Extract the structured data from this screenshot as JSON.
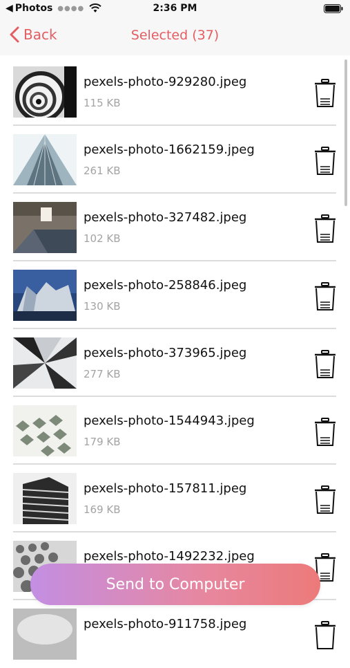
{
  "status_bar": {
    "back_app": "Photos",
    "time": "2:36 PM"
  },
  "nav": {
    "back_label": "Back",
    "title": "Selected (37)"
  },
  "files": [
    {
      "name": "pexels-photo-929280.jpeg",
      "size": "115 KB"
    },
    {
      "name": "pexels-photo-1662159.jpeg",
      "size": "261 KB"
    },
    {
      "name": "pexels-photo-327482.jpeg",
      "size": "102 KB"
    },
    {
      "name": "pexels-photo-258846.jpeg",
      "size": "130 KB"
    },
    {
      "name": "pexels-photo-373965.jpeg",
      "size": "277 KB"
    },
    {
      "name": "pexels-photo-1544943.jpeg",
      "size": "179 KB"
    },
    {
      "name": "pexels-photo-157811.jpeg",
      "size": "169 KB"
    },
    {
      "name": "pexels-photo-1492232.jpeg",
      "size": ""
    },
    {
      "name": "pexels-photo-911758.jpeg",
      "size": ""
    }
  ],
  "send_button_label": "Send to Computer",
  "colors": {
    "accent": "#e35d62",
    "button_gradient_start": "#c38ee3",
    "button_gradient_end": "#ec7a7a"
  },
  "icons": [
    "wifi-icon",
    "battery-icon",
    "chevron-left-icon",
    "trash-icon"
  ]
}
